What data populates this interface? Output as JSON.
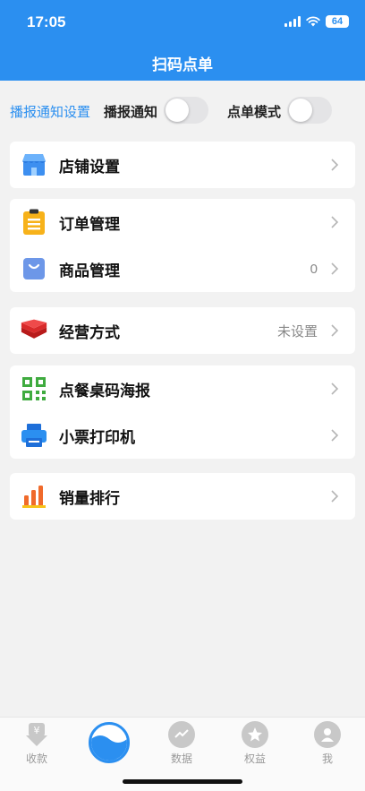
{
  "status_bar": {
    "time": "17:05",
    "battery": "64"
  },
  "header": {
    "title": "扫码点单"
  },
  "toggles": {
    "settings_link": "播报通知设置",
    "broadcast_label": "播报通知",
    "order_mode_label": "点单模式",
    "broadcast_on": false,
    "order_mode_on": false
  },
  "menu": {
    "store_settings": {
      "label": "店铺设置",
      "icon": "shop-icon"
    },
    "order_management": {
      "label": "订单管理",
      "icon": "clipboard-icon"
    },
    "product_management": {
      "label": "商品管理",
      "value": "0",
      "icon": "bag-icon"
    },
    "business_mode": {
      "label": "经营方式",
      "value": "未设置",
      "icon": "layers-icon"
    },
    "table_qr_poster": {
      "label": "点餐桌码海报",
      "icon": "qr-code-icon"
    },
    "receipt_printer": {
      "label": "小票打印机",
      "icon": "printer-icon"
    },
    "sales_ranking": {
      "label": "销量排行",
      "icon": "bar-chart-icon"
    }
  },
  "tabbar": {
    "collect": "收款",
    "data": "数据",
    "benefits": "权益",
    "me": "我"
  },
  "colors": {
    "primary": "#2b8ff0",
    "background": "#f2f2f2",
    "text": "#111111",
    "muted": "#888888"
  }
}
